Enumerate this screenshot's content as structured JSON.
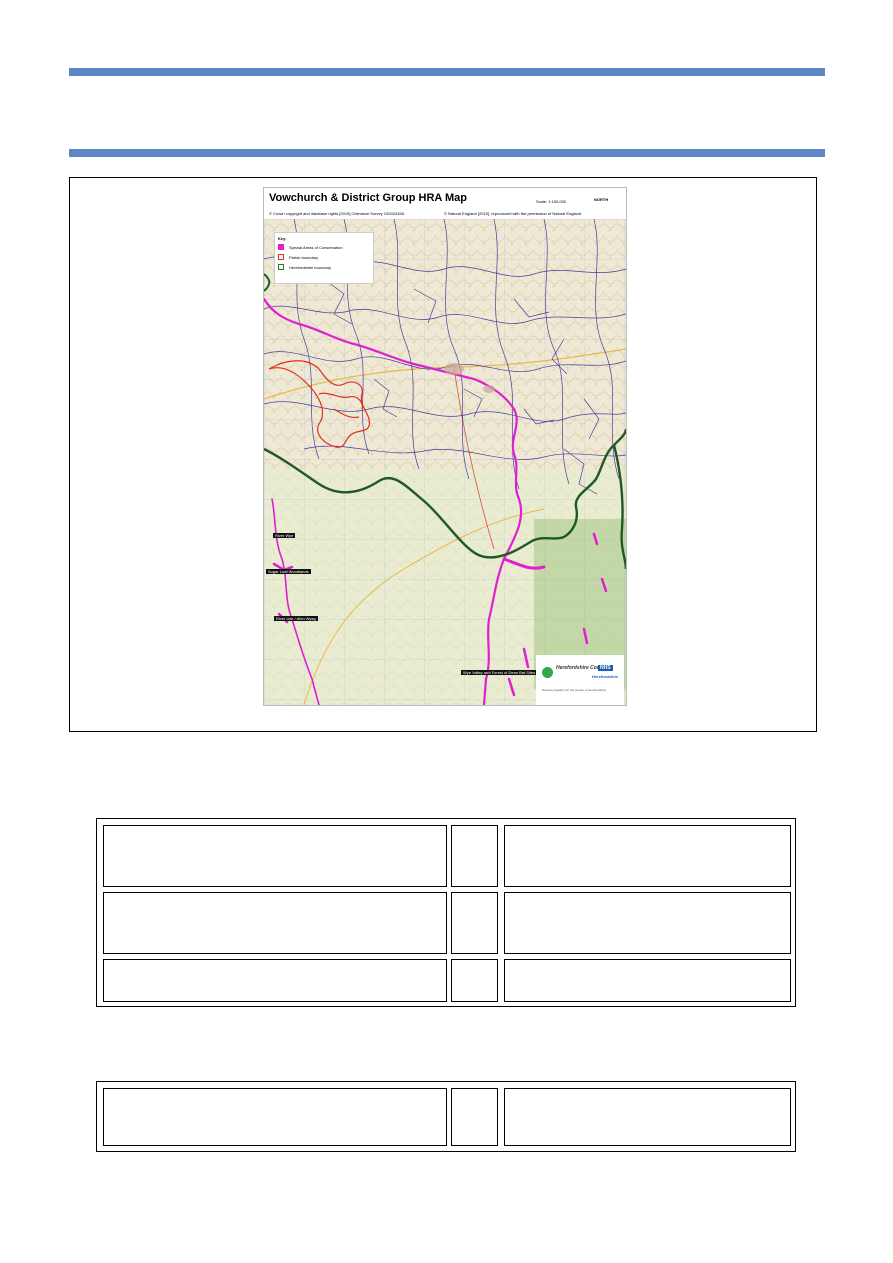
{
  "map": {
    "title": "Vowchurch & District Group HRA Map",
    "scale": "Scale: 1:150,000",
    "copyright_os": "© Crown copyright and database rights [2015] Ordnance Survey 100024168.",
    "copyright_ne": "© Natural England [2015], reproduced with the permission of Natural England",
    "logo_text": "NORTH",
    "key": {
      "title": "Key:",
      "items": [
        {
          "label": "Special Areas of Conservation",
          "color": "#e020d0",
          "style": "fill"
        },
        {
          "label": "Parish boundary",
          "color": "#e03020",
          "style": "outline"
        },
        {
          "label": "Herefordshire boundary",
          "color": "#1e7a2e",
          "style": "outline"
        }
      ]
    },
    "labels": [
      {
        "text": "River Wye"
      },
      {
        "text": "Sugar Loaf Woodlands"
      },
      {
        "text": "River Usk / Afon Wysg"
      },
      {
        "text": "Wye Valley and Forest of Dean Bat Sites"
      }
    ],
    "council_logo": {
      "name": "Herefordshire Council",
      "nhs": "NHS",
      "nhs_sub": "Herefordshire",
      "tagline": "Working together for the people of Herefordshire"
    }
  }
}
